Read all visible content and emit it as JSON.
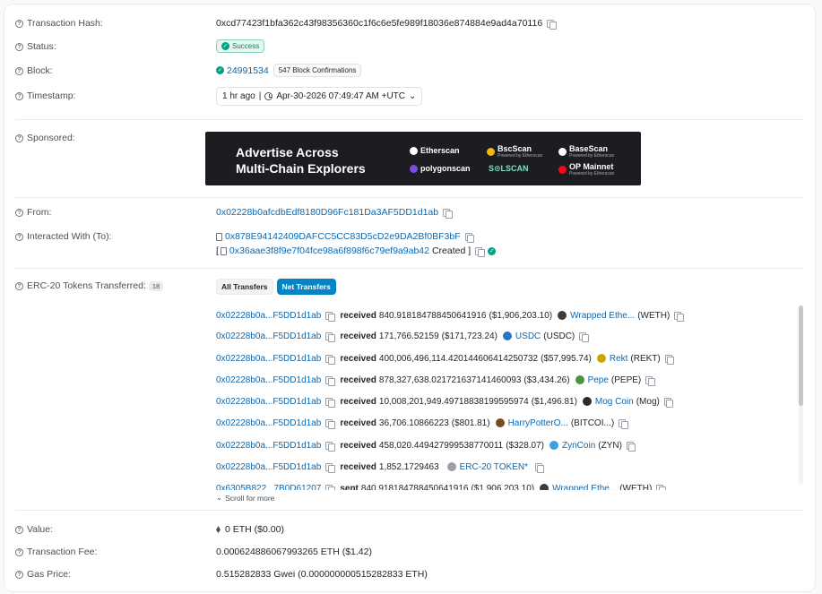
{
  "labels": {
    "tx_hash": "Transaction Hash:",
    "status": "Status:",
    "block": "Block:",
    "timestamp": "Timestamp:",
    "sponsored": "Sponsored:",
    "from": "From:",
    "interacted": "Interacted With (To):",
    "erc20": "ERC-20 Tokens Transferred:",
    "value": "Value:",
    "fee": "Transaction Fee:",
    "gas_price": "Gas Price:"
  },
  "tx_hash": "0xcd77423f1bfa362c43f98356360c1f6c6e5fe989f18036e874884e9ad4a70116",
  "status": "Success",
  "block": {
    "number": "24991534",
    "confirmations": "547 Block Confirmations"
  },
  "timestamp": {
    "ago": "1 hr ago",
    "date": "Apr-30-2026 07:49:47 AM +UTC",
    "caret": "⌄"
  },
  "ad": {
    "line1": "Advertise Across",
    "line2": "Multi-Chain Explorers",
    "logos": [
      {
        "name": "Etherscan",
        "sub": ""
      },
      {
        "name": "BscScan",
        "sub": "Powered by Etherscan"
      },
      {
        "name": "BaseScan",
        "sub": "Powered by Etherscan"
      },
      {
        "name": "polygonscan",
        "sub": ""
      },
      {
        "name": "S⊙LSCAN",
        "sub": ""
      },
      {
        "name": "OP Mainnet",
        "sub": "Powered by Etherscan"
      }
    ]
  },
  "from": "0x02228b0afcdbEdf8180D96Fc181Da3AF5DD1d1ab",
  "interacted": {
    "address": "0x878E94142409DAFCC5CC83D5cD2e9DA2Bf0BF3bF",
    "bracket": "[",
    "created_address": "0x36aae3f8f9e7f04fce98a6f898f6c79ef9a9ab42",
    "created_label": "Created ]"
  },
  "erc20": {
    "count": "18",
    "tab_all": "All Transfers",
    "tab_net": "Net Transfers",
    "rows": [
      {
        "address": "0x02228b0a...F5DD1d1ab",
        "dir": "received",
        "amount": "840.918184788450641916",
        "usd": "($1,906,203.10)",
        "token": "Wrapped Ethe...",
        "symbol": "(WETH)",
        "color": "#3c3c3d"
      },
      {
        "address": "0x02228b0a...F5DD1d1ab",
        "dir": "received",
        "amount": "171,766.52159",
        "usd": "($171,723.24)",
        "token": "USDC",
        "symbol": "(USDC)",
        "color": "#2775ca"
      },
      {
        "address": "0x02228b0a...F5DD1d1ab",
        "dir": "received",
        "amount": "400,006,496,114.420144606414250732",
        "usd": "($57,995.74)",
        "token": "Rekt",
        "symbol": "(REKT)",
        "color": "#c8a800"
      },
      {
        "address": "0x02228b0a...F5DD1d1ab",
        "dir": "received",
        "amount": "878,327,638.021721637141460093",
        "usd": "($3,434.26)",
        "token": "Pepe",
        "symbol": "(PEPE)",
        "color": "#4c9540"
      },
      {
        "address": "0x02228b0a...F5DD1d1ab",
        "dir": "received",
        "amount": "10,008,201,949.49718838199595974",
        "usd": "($1,496.81)",
        "token": "Mog Coin",
        "symbol": "(Mog)",
        "color": "#2b2b2b"
      },
      {
        "address": "0x02228b0a...F5DD1d1ab",
        "dir": "received",
        "amount": "36,706.10866223",
        "usd": "($801.81)",
        "token": "HarryPotterO...",
        "symbol": "(BITCOI...)",
        "color": "#7a4a20"
      },
      {
        "address": "0x02228b0a...F5DD1d1ab",
        "dir": "received",
        "amount": "458,020.449427999538770011",
        "usd": "($328.07)",
        "token": "ZynCoin",
        "symbol": "(ZYN)",
        "color": "#3aa0e0"
      },
      {
        "address": "0x02228b0a...F5DD1d1ab",
        "dir": "received",
        "amount": "1,852.1729463",
        "usd": "",
        "token": "ERC-20 TOKEN*",
        "symbol": "",
        "color": "#9aa0a6"
      },
      {
        "address": "0x6305B822...7B0D61207",
        "dir": "sent",
        "amount": "840.918184788450641916",
        "usd": "($1,906,203.10)",
        "token": "Wrapped Ethe...",
        "symbol": "(WETH)",
        "color": "#3c3c3d"
      }
    ],
    "scroll_more": "Scroll for more"
  },
  "value": "0 ETH ($0.00)",
  "fee": "0.000624886067993265 ETH ($1.42)",
  "gas_price": "0.515282833 Gwei (0.000000000515282833 ETH)"
}
